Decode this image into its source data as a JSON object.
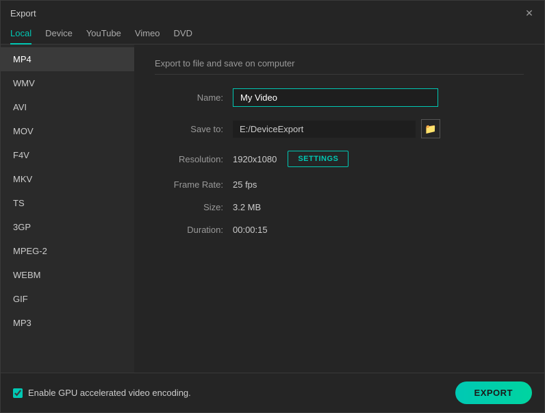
{
  "window": {
    "title": "Export"
  },
  "tabs": [
    {
      "id": "local",
      "label": "Local",
      "active": true
    },
    {
      "id": "device",
      "label": "Device",
      "active": false
    },
    {
      "id": "youtube",
      "label": "YouTube",
      "active": false
    },
    {
      "id": "vimeo",
      "label": "Vimeo",
      "active": false
    },
    {
      "id": "dvd",
      "label": "DVD",
      "active": false
    }
  ],
  "formats": [
    {
      "id": "mp4",
      "label": "MP4",
      "active": true
    },
    {
      "id": "wmv",
      "label": "WMV",
      "active": false
    },
    {
      "id": "avi",
      "label": "AVI",
      "active": false
    },
    {
      "id": "mov",
      "label": "MOV",
      "active": false
    },
    {
      "id": "f4v",
      "label": "F4V",
      "active": false
    },
    {
      "id": "mkv",
      "label": "MKV",
      "active": false
    },
    {
      "id": "ts",
      "label": "TS",
      "active": false
    },
    {
      "id": "3gp",
      "label": "3GP",
      "active": false
    },
    {
      "id": "mpeg2",
      "label": "MPEG-2",
      "active": false
    },
    {
      "id": "webm",
      "label": "WEBM",
      "active": false
    },
    {
      "id": "gif",
      "label": "GIF",
      "active": false
    },
    {
      "id": "mp3",
      "label": "MP3",
      "active": false
    }
  ],
  "panel": {
    "title": "Export to file and save on computer",
    "name_label": "Name:",
    "name_value": "My Video",
    "save_to_label": "Save to:",
    "save_to_path": "E:/DeviceExport",
    "resolution_label": "Resolution:",
    "resolution_value": "1920x1080",
    "settings_label": "SETTINGS",
    "frame_rate_label": "Frame Rate:",
    "frame_rate_value": "25 fps",
    "size_label": "Size:",
    "size_value": "3.2 MB",
    "duration_label": "Duration:",
    "duration_value": "00:00:15"
  },
  "bottom": {
    "gpu_label": "Enable GPU accelerated video encoding.",
    "export_label": "EXPORT"
  },
  "icons": {
    "close": "✕",
    "folder": "🗁"
  }
}
